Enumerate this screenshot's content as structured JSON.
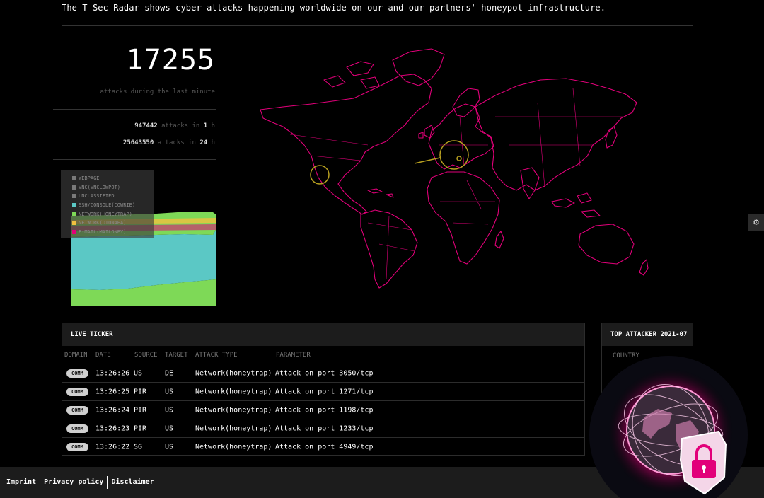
{
  "intro": "The T-Sec Radar shows cyber attacks happening worldwide on our and our partners' honeypot infrastructure.",
  "stats": {
    "minute_count": "17255",
    "minute_label": "attacks during the last minute",
    "hour_count": "947442",
    "hour_text": "attacks in",
    "hour_unit_n": "1",
    "hour_unit": "h",
    "day_count": "25643550",
    "day_text": "attacks in",
    "day_unit_n": "24",
    "day_unit": "h"
  },
  "legend": [
    {
      "label": "WEBPAGE",
      "color": "#7a7a7a"
    },
    {
      "label": "VNC(VNCLOWPOT)",
      "color": "#7a7a7a"
    },
    {
      "label": "UNCLASSIFIED",
      "color": "#7a7a7a"
    },
    {
      "label": "SSH/CONSOLE(COWRIE)",
      "color": "#5bc8c5"
    },
    {
      "label": "NETWORK(HONEYTRAP)",
      "color": "#7ed957"
    },
    {
      "label": "NETWORK(DIONAEA)",
      "color": "#f0c040"
    },
    {
      "label": "E-MAIL(MAILONEY)",
      "color": "#e2007a"
    }
  ],
  "colors": {
    "map_line": "#e2007a",
    "accent": "#e2007a",
    "cowrie": "#5bc8c5",
    "honeytrap": "#7ed957",
    "attack_circle": "#b8a020"
  },
  "settings_icon": "gear-icon",
  "ticker": {
    "title": "LIVE TICKER",
    "columns": [
      "DOMAIN",
      "DATE",
      "SOURCE",
      "TARGET",
      "ATTACK TYPE",
      "PARAMETER"
    ],
    "rows": [
      {
        "domain": "COMM",
        "date": "13:26:26",
        "source": "US",
        "target": "DE",
        "type": "Network(honeytrap)",
        "param": "Attack on port 3050/tcp"
      },
      {
        "domain": "COMM",
        "date": "13:26:25",
        "source": "PIR",
        "target": "US",
        "type": "Network(honeytrap)",
        "param": "Attack on port 1271/tcp"
      },
      {
        "domain": "COMM",
        "date": "13:26:24",
        "source": "PIR",
        "target": "US",
        "type": "Network(honeytrap)",
        "param": "Attack on port 1198/tcp"
      },
      {
        "domain": "COMM",
        "date": "13:26:23",
        "source": "PIR",
        "target": "US",
        "type": "Network(honeytrap)",
        "param": "Attack on port 1233/tcp"
      },
      {
        "domain": "COMM",
        "date": "13:26:22",
        "source": "SG",
        "target": "US",
        "type": "Network(honeytrap)",
        "param": "Attack on port 4949/tcp"
      }
    ]
  },
  "top_attacker": {
    "title": "TOP ATTACKER 2021-07",
    "col": "COUNTRY"
  },
  "footer": {
    "links": [
      "Imprint",
      "Privacy policy",
      "Disclaimer"
    ]
  }
}
